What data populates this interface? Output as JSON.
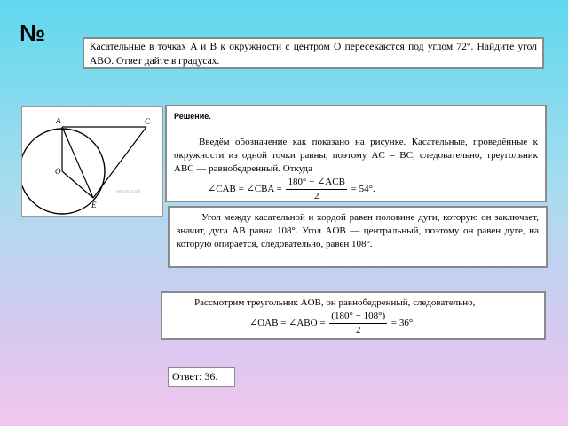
{
  "number_sign": "№",
  "task": {
    "text": "Касательные в точках A и B к окружности с центром O пересекаются под углом 72°. Найдите угол ABO. Ответ дайте в градусах."
  },
  "figure": {
    "labels": {
      "A": "A",
      "C": "C",
      "O": "O",
      "E": "E"
    },
    "watermark": "решуогэ.рф"
  },
  "solution1": {
    "heading": "Решение.",
    "text": "Введём обозначение как показано на рисунке. Касательные, проведённые к окружности из одной точки равны, поэтому AC = BC, следовательно, треугольник ABC — равнобедренный. Откуда",
    "formula_left": "∠CAB = ∠CBA =",
    "formula_num": "180° − ∠ACB",
    "formula_den": "2",
    "formula_right": "= 54°."
  },
  "solution2": {
    "text": "Угол между касательной и хордой равен половине дуги, которую он заключает, значит, дуга AB равна 108°. Угол AOB — центральный, поэтому он равен дуге, на которую опирается, следовательно, равен 108°."
  },
  "solution3": {
    "text": "Рассмотрим треугольник AOB, он равнобедренный, следовательно,",
    "formula_left": "∠OAB = ∠ABO =",
    "formula_num": "(180° − 108°)",
    "formula_den": "2",
    "formula_right": "= 36°."
  },
  "answer": {
    "text": "Ответ: 36."
  }
}
